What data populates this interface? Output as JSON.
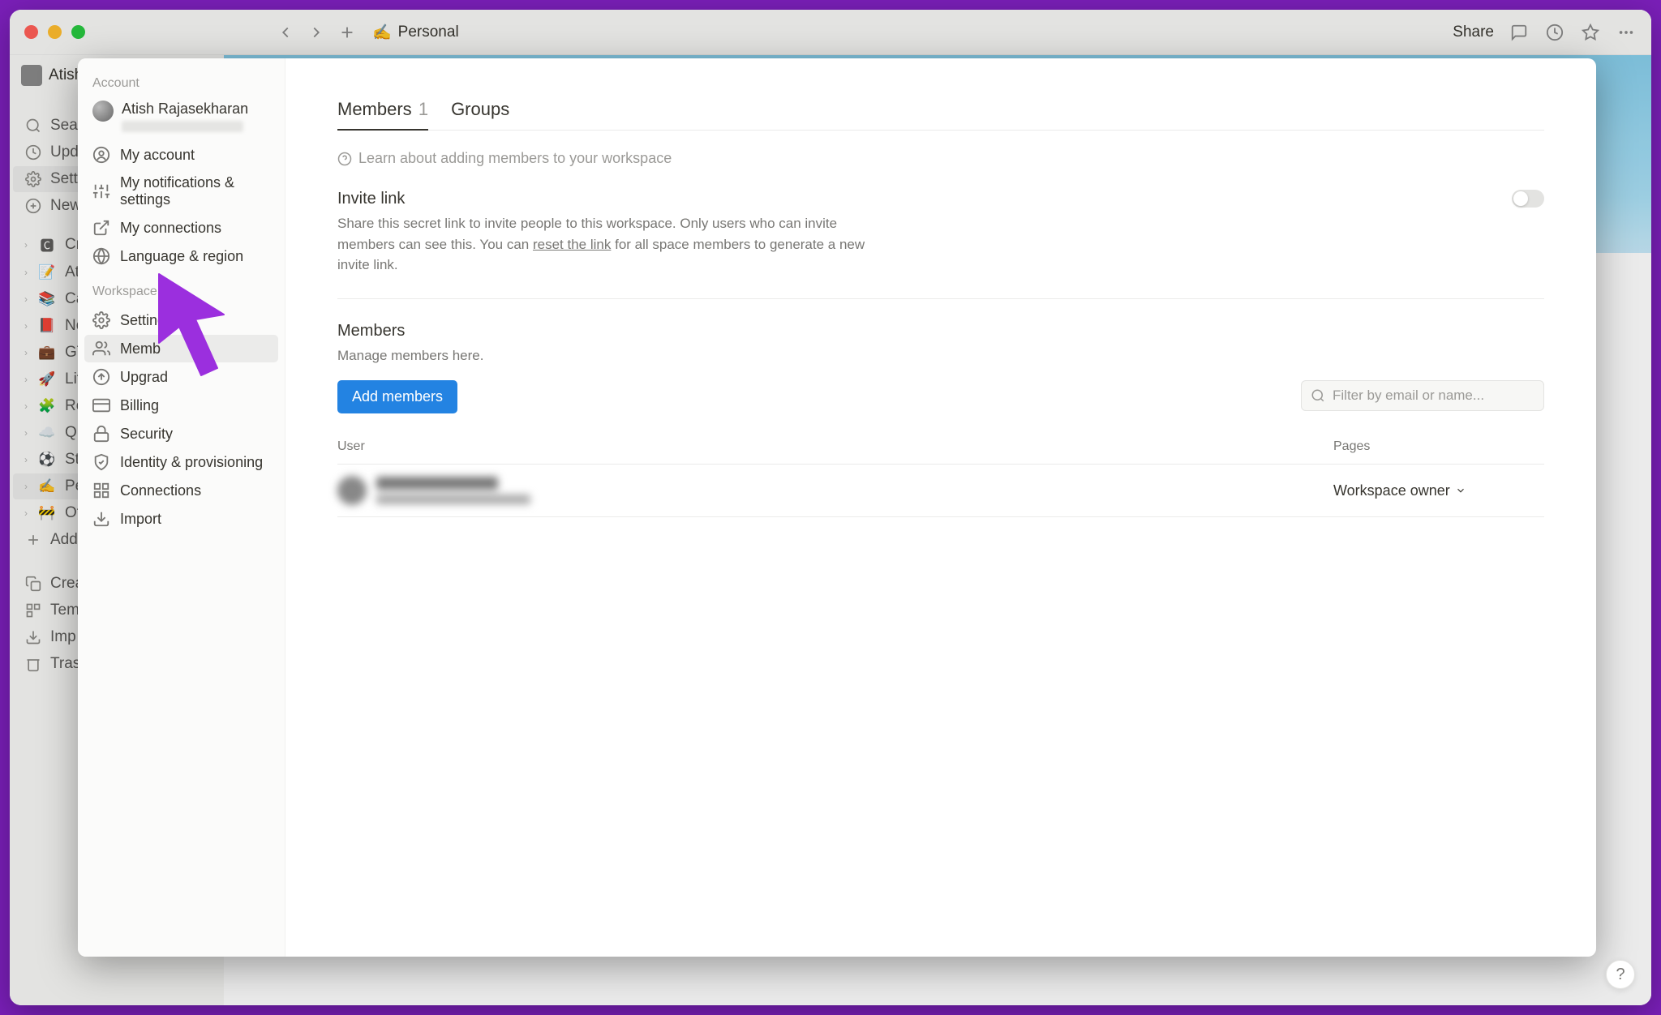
{
  "titlebar": {
    "page_emoji": "✍️",
    "page_title": "Personal",
    "share": "Share"
  },
  "sidebar": {
    "user_name": "Atish",
    "items_top": [
      {
        "icon": "search",
        "label": "Sea"
      },
      {
        "icon": "clock",
        "label": "Upd"
      },
      {
        "icon": "gear",
        "label": "Sett"
      },
      {
        "icon": "plus-circle",
        "label": "New"
      }
    ],
    "pages": [
      {
        "emoji": "🅲",
        "label": "Cr"
      },
      {
        "emoji": "📝",
        "label": "Ati"
      },
      {
        "emoji": "📚",
        "label": "Ca"
      },
      {
        "emoji": "📕",
        "label": "No"
      },
      {
        "emoji": "💼",
        "label": "GT"
      },
      {
        "emoji": "🚀",
        "label": "Lif"
      },
      {
        "emoji": "🧩",
        "label": "Re"
      },
      {
        "emoji": "☁️",
        "label": "Qu"
      },
      {
        "emoji": "⚽",
        "label": "Sta"
      },
      {
        "emoji": "✍️",
        "label": "Pe",
        "selected": true
      },
      {
        "emoji": "🚧",
        "label": "Ot"
      }
    ],
    "add_page": "Add a",
    "bottom": [
      {
        "icon": "duplicate",
        "label": "Crea"
      },
      {
        "icon": "template",
        "label": "Tem"
      },
      {
        "icon": "download",
        "label": "Imp"
      },
      {
        "icon": "trash",
        "label": "Tras"
      }
    ]
  },
  "settings_sidebar": {
    "account_label": "Account",
    "user_name": "Atish Rajasekharan",
    "account_items": [
      {
        "icon": "user-circle",
        "label": "My account"
      },
      {
        "icon": "sliders",
        "label": "My notifications & settings"
      },
      {
        "icon": "arrow-out",
        "label": "My connections"
      },
      {
        "icon": "globe",
        "label": "Language & region"
      }
    ],
    "workspace_label": "Workspace",
    "workspace_items": [
      {
        "icon": "gear",
        "label": "Settings"
      },
      {
        "icon": "people",
        "label": "Memb",
        "active": true
      },
      {
        "icon": "arrow-up-circle",
        "label": "Upgrad"
      },
      {
        "icon": "card",
        "label": "Billing"
      },
      {
        "icon": "lock",
        "label": "Security"
      },
      {
        "icon": "shield",
        "label": "Identity & provisioning"
      },
      {
        "icon": "grid",
        "label": "Connections"
      },
      {
        "icon": "download",
        "label": "Import"
      }
    ]
  },
  "members_panel": {
    "tab_members": "Members",
    "tab_members_count": "1",
    "tab_groups": "Groups",
    "learn_text": "Learn about adding members to your workspace",
    "invite_title": "Invite link",
    "invite_desc_1": "Share this secret link to invite people to this workspace. Only users who can invite members can see this. You can ",
    "invite_reset": "reset the link",
    "invite_desc_2": " for all space members to generate a new invite link.",
    "members_title": "Members",
    "members_desc": "Manage members here.",
    "add_button": "Add members",
    "filter_placeholder": "Filter by email or name...",
    "col_user": "User",
    "col_pages": "Pages",
    "role": "Workspace owner"
  }
}
